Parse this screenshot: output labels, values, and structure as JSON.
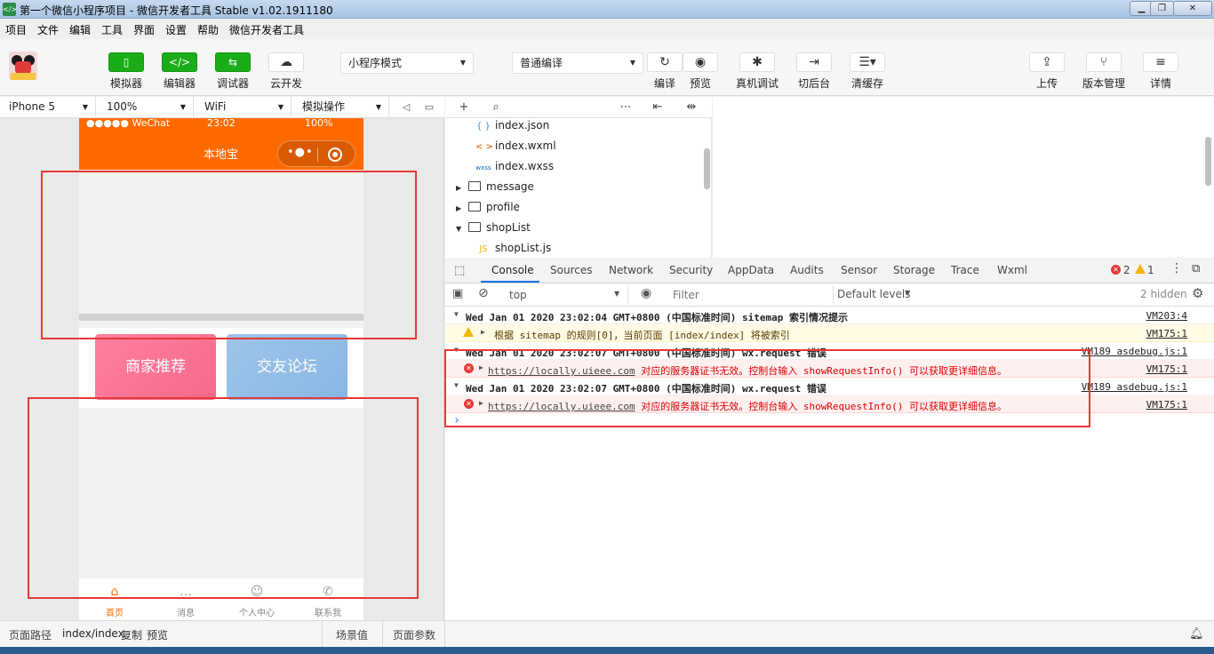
{
  "window": {
    "title": "第一个微信小程序项目 - 微信开发者工具 Stable v1.02.1911180",
    "app_icon": "</>"
  },
  "menu": [
    "项目",
    "文件",
    "编辑",
    "工具",
    "界面",
    "设置",
    "帮助",
    "微信开发者工具"
  ],
  "toolbar": {
    "simulator": "模拟器",
    "editor": "编辑器",
    "debugger": "调试器",
    "cloud": "云开发",
    "mode_select": "小程序模式",
    "compile_select": "普通编译",
    "compile": "编译",
    "preview": "预览",
    "remote_debug": "真机调试",
    "background": "切后台",
    "clear_cache": "清缓存",
    "upload": "上传",
    "version": "版本管理",
    "details": "详情"
  },
  "simbar": {
    "device": "iPhone 5",
    "zoom": "100%",
    "network": "WiFi",
    "operation": "模拟操作"
  },
  "phone": {
    "status_carrier": "●●●●● WeChat",
    "status_time": "23:02",
    "status_battery": "100%",
    "nav_title": "本地宝",
    "tile1": "商家推荐",
    "tile2": "交友论坛",
    "tabs": [
      {
        "label": "首页",
        "icon": "⌂"
      },
      {
        "label": "消息",
        "icon": "…"
      },
      {
        "label": "个人中心",
        "icon": "☺"
      },
      {
        "label": "联系我",
        "icon": "✆"
      }
    ]
  },
  "filetree": {
    "items": [
      {
        "type": "file",
        "icon": "{ }",
        "icon_color": "#2196f3",
        "name": "index.json"
      },
      {
        "type": "file",
        "icon": "< >",
        "icon_color": "#e65100",
        "name": "index.wxml"
      },
      {
        "type": "file",
        "icon": "wxss",
        "icon_color": "#1565c0",
        "name": "index.wxss"
      },
      {
        "type": "folder",
        "arrow": "▶",
        "name": "message"
      },
      {
        "type": "folder",
        "arrow": "▶",
        "name": "profile"
      },
      {
        "type": "folder",
        "arrow": "▼",
        "name": "shopList"
      },
      {
        "type": "file",
        "icon": "JS",
        "icon_color": "#f0b400",
        "name": "shopList.js"
      }
    ]
  },
  "devtools": {
    "tabs": [
      "Console",
      "Sources",
      "Network",
      "Security",
      "AppData",
      "Audits",
      "Sensor",
      "Storage",
      "Trace",
      "Wxml"
    ],
    "errors_count": "2",
    "warnings_count": "1",
    "context": "top",
    "filter_placeholder": "Filter",
    "levels": "Default levels",
    "hidden": "2 hidden"
  },
  "console": {
    "rows": [
      {
        "kind": "group",
        "text": "Wed Jan 01 2020 23:02:04 GMT+0800 (中国标准时间) sitemap 索引情况提示",
        "src": "VM203:4"
      },
      {
        "kind": "warn",
        "text": "根据 sitemap 的规则[0]，当前页面 [index/index] 将被索引",
        "src": "VM175:1"
      },
      {
        "kind": "group",
        "text": "Wed Jan 01 2020 23:02:07 GMT+0800 (中国标准时间) wx.request 错误",
        "src": "VM189 asdebug.js:1"
      },
      {
        "kind": "err",
        "link": "https://locally.uieee.com",
        "text": " 对应的服务器证书无效。控制台输入 showRequestInfo() 可以获取更详细信息。",
        "src": "VM175:1"
      },
      {
        "kind": "group",
        "text": "Wed Jan 01 2020 23:02:07 GMT+0800 (中国标准时间) wx.request 错误",
        "src": "VM189 asdebug.js:1"
      },
      {
        "kind": "err",
        "link": "https://locally.uieee.com",
        "text": " 对应的服务器证书无效。控制台输入 showRequestInfo() 可以获取更详细信息。",
        "src": "VM175:1"
      }
    ],
    "prompt": "›"
  },
  "statusbar": {
    "path_label": "页面路径",
    "path": "index/index",
    "copy": "复制",
    "preview": "预览",
    "scene": "场景值",
    "params": "页面参数"
  },
  "colors": {
    "accent_green": "#1aad19",
    "nav_orange": "#ff6a00",
    "annotation_red": "#e53935"
  }
}
